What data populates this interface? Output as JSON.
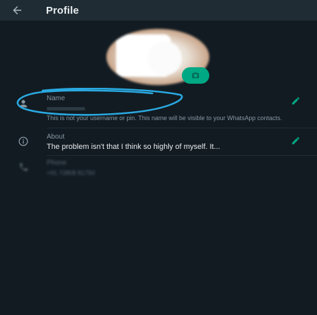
{
  "header": {
    "title": "Profile",
    "back_icon": "arrow-left-icon"
  },
  "profile_photo": {
    "camera_icon": "camera-icon"
  },
  "name_row": {
    "label": "Name",
    "value": "",
    "hint": "This is not your username or pin. This name will be visible to your WhatsApp contacts.",
    "icon": "person-icon",
    "edit_icon": "pencil-icon"
  },
  "about_row": {
    "label": "About",
    "value": "The problem isn't that I think so highly of myself. It...",
    "icon": "info-icon",
    "edit_icon": "pencil-icon"
  },
  "phone_row": {
    "label": "Phone",
    "value": "+91 72808 81750",
    "icon": "phone-icon"
  },
  "colors": {
    "background": "#121b22",
    "header": "#1f2c34",
    "accent": "#00a884",
    "annotation": "#2aa9e0"
  }
}
